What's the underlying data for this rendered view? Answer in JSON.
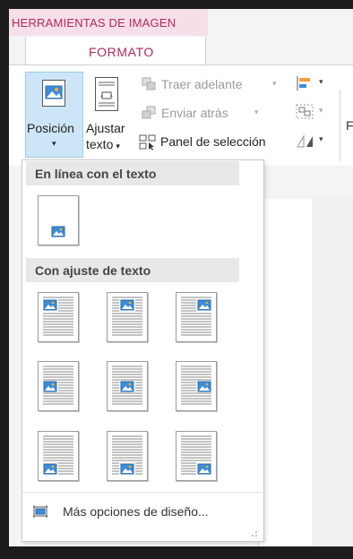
{
  "contextual_tab": {
    "header": "HERRAMIENTAS DE IMAGEN",
    "tab": "FORMATO"
  },
  "ribbon": {
    "posicion": {
      "label": "Posición",
      "arrow": "▾"
    },
    "ajustar": {
      "label_line1": "Ajustar",
      "label_line2": "texto",
      "arrow": "▾"
    },
    "traer_adelante": {
      "label": "Traer adelante",
      "arrow": "▾"
    },
    "enviar_atras": {
      "label": "Enviar atrás",
      "arrow": "▾"
    },
    "panel_seleccion": {
      "label": "Panel de selección"
    },
    "cut_letter": "F"
  },
  "dropdown": {
    "section_inline": "En línea con el texto",
    "section_wrap": "Con ajuste de texto",
    "more_options": "Más opciones de diseño..."
  },
  "colors": {
    "accent": "#b2285a",
    "selected_bg": "#cde6f7",
    "image_blue": "#3c8dd8"
  }
}
